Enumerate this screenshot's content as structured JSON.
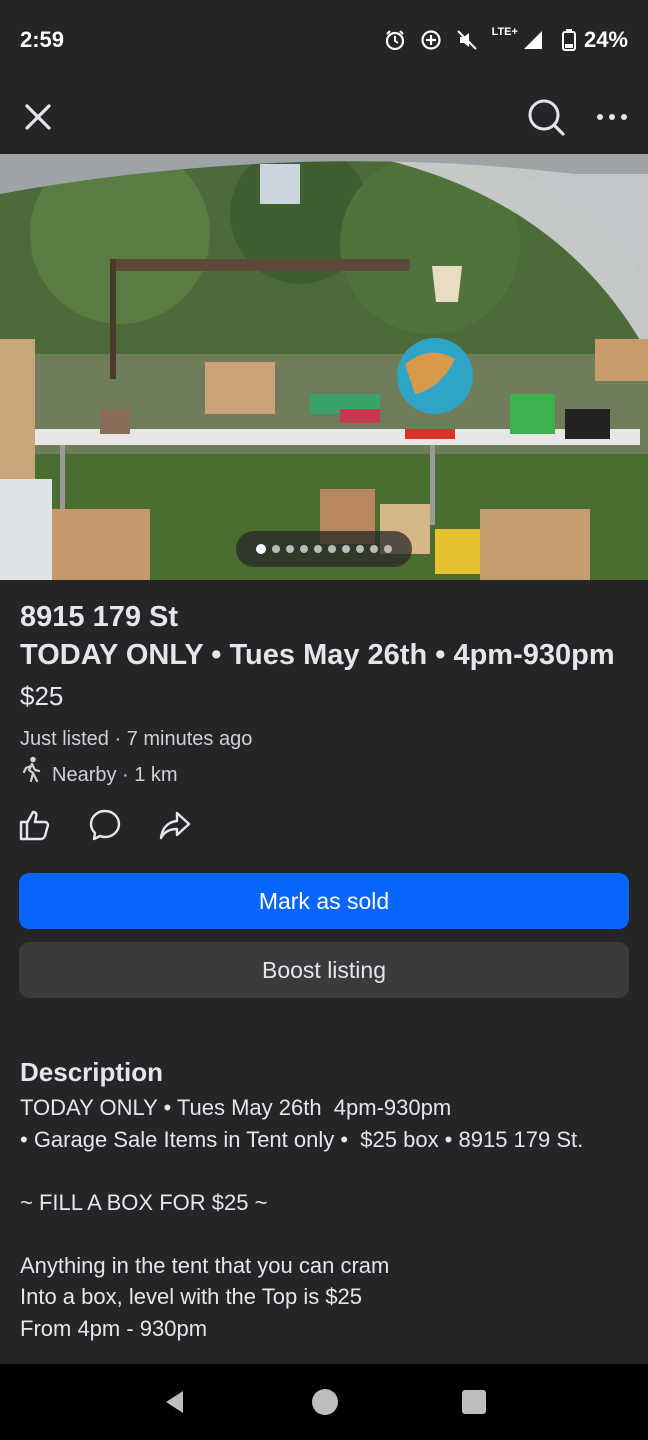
{
  "status_bar": {
    "time": "2:59",
    "network": "LTE+",
    "battery": "24%"
  },
  "listing": {
    "address": "8915 179 St",
    "title": "TODAY ONLY • Tues May 26th • 4pm-930pm",
    "price": "$25",
    "listed": "Just listed · 7 minutes ago",
    "nearby": "Nearby · 1 km",
    "photo_count": 10,
    "photo_index": 1
  },
  "buttons": {
    "mark_sold": "Mark as sold",
    "boost": "Boost listing"
  },
  "description": {
    "heading": "Description",
    "lines": [
      "TODAY ONLY • Tues May 26th  4pm-930pm",
      "• Garage Sale Items in Tent only •  $25 box • 8915 179 St.",
      "",
      "~ FILL A BOX FOR $25 ~",
      "",
      "Anything in the tent that you can cram",
      "Into a box, level with the Top is $25",
      "From 4pm - 930pm"
    ]
  },
  "icons": {
    "close": "close-icon",
    "search": "search-icon",
    "more": "more-icon",
    "like": "thumbs-up-icon",
    "comment": "comment-icon",
    "share": "share-icon",
    "walk": "walking-person-icon"
  },
  "colors": {
    "primary": "#0866ff",
    "background": "#242526",
    "secondary_button": "#3a3b3c"
  }
}
